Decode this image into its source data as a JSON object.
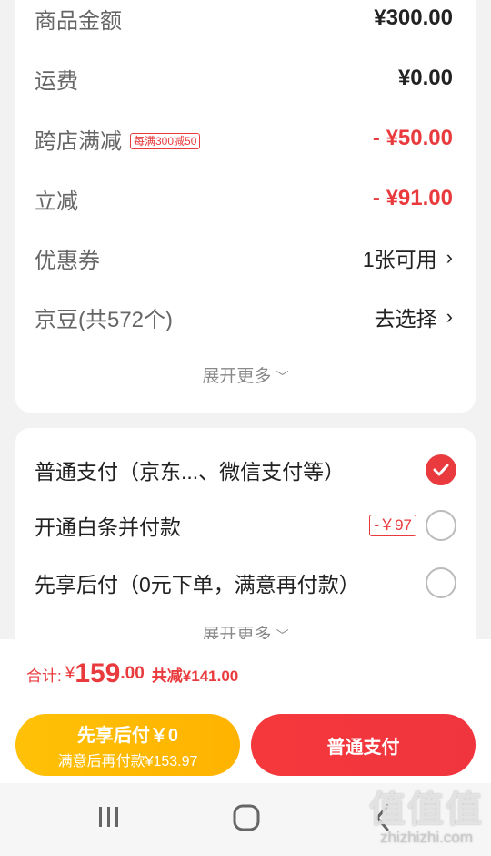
{
  "summary": {
    "rows": [
      {
        "label": "商品金额",
        "value": "¥300.00"
      },
      {
        "label": "运费",
        "value": "¥0.00"
      },
      {
        "label": "跨店满减",
        "tag": "每满300减50",
        "value": "- ¥50.00"
      },
      {
        "label": "立减",
        "value": "- ¥91.00"
      },
      {
        "label": "优惠券",
        "value": "1张可用"
      },
      {
        "label": "京豆(共572个)",
        "value": "去选择"
      }
    ],
    "expand_label": "展开更多"
  },
  "payment": {
    "options": [
      {
        "label": "普通支付（京东...、微信支付等）",
        "selected": true
      },
      {
        "label": "开通白条并付款",
        "badge": "-￥97",
        "selected": false
      },
      {
        "label": "先享后付（0元下单，满意再付款）",
        "selected": false
      }
    ],
    "expand_label": "展开更多"
  },
  "total": {
    "label": "合计:",
    "currency": "¥",
    "amount_int": "159",
    "amount_dec": ".00",
    "discount": "共减¥141.00"
  },
  "actions": {
    "later_main": "先享后付￥0",
    "later_sub": "满意后再付款¥153.97",
    "normal": "普通支付"
  },
  "nav": {
    "icons": [
      "recent-apps-icon",
      "home-icon",
      "back-icon"
    ]
  },
  "watermark": {
    "big": "值值值",
    "small": "zhizhizhi.com"
  },
  "colors": {
    "accent_red": "#e93b3d",
    "later_yellow": "#ffbb00",
    "background": "#f2f2f2"
  }
}
